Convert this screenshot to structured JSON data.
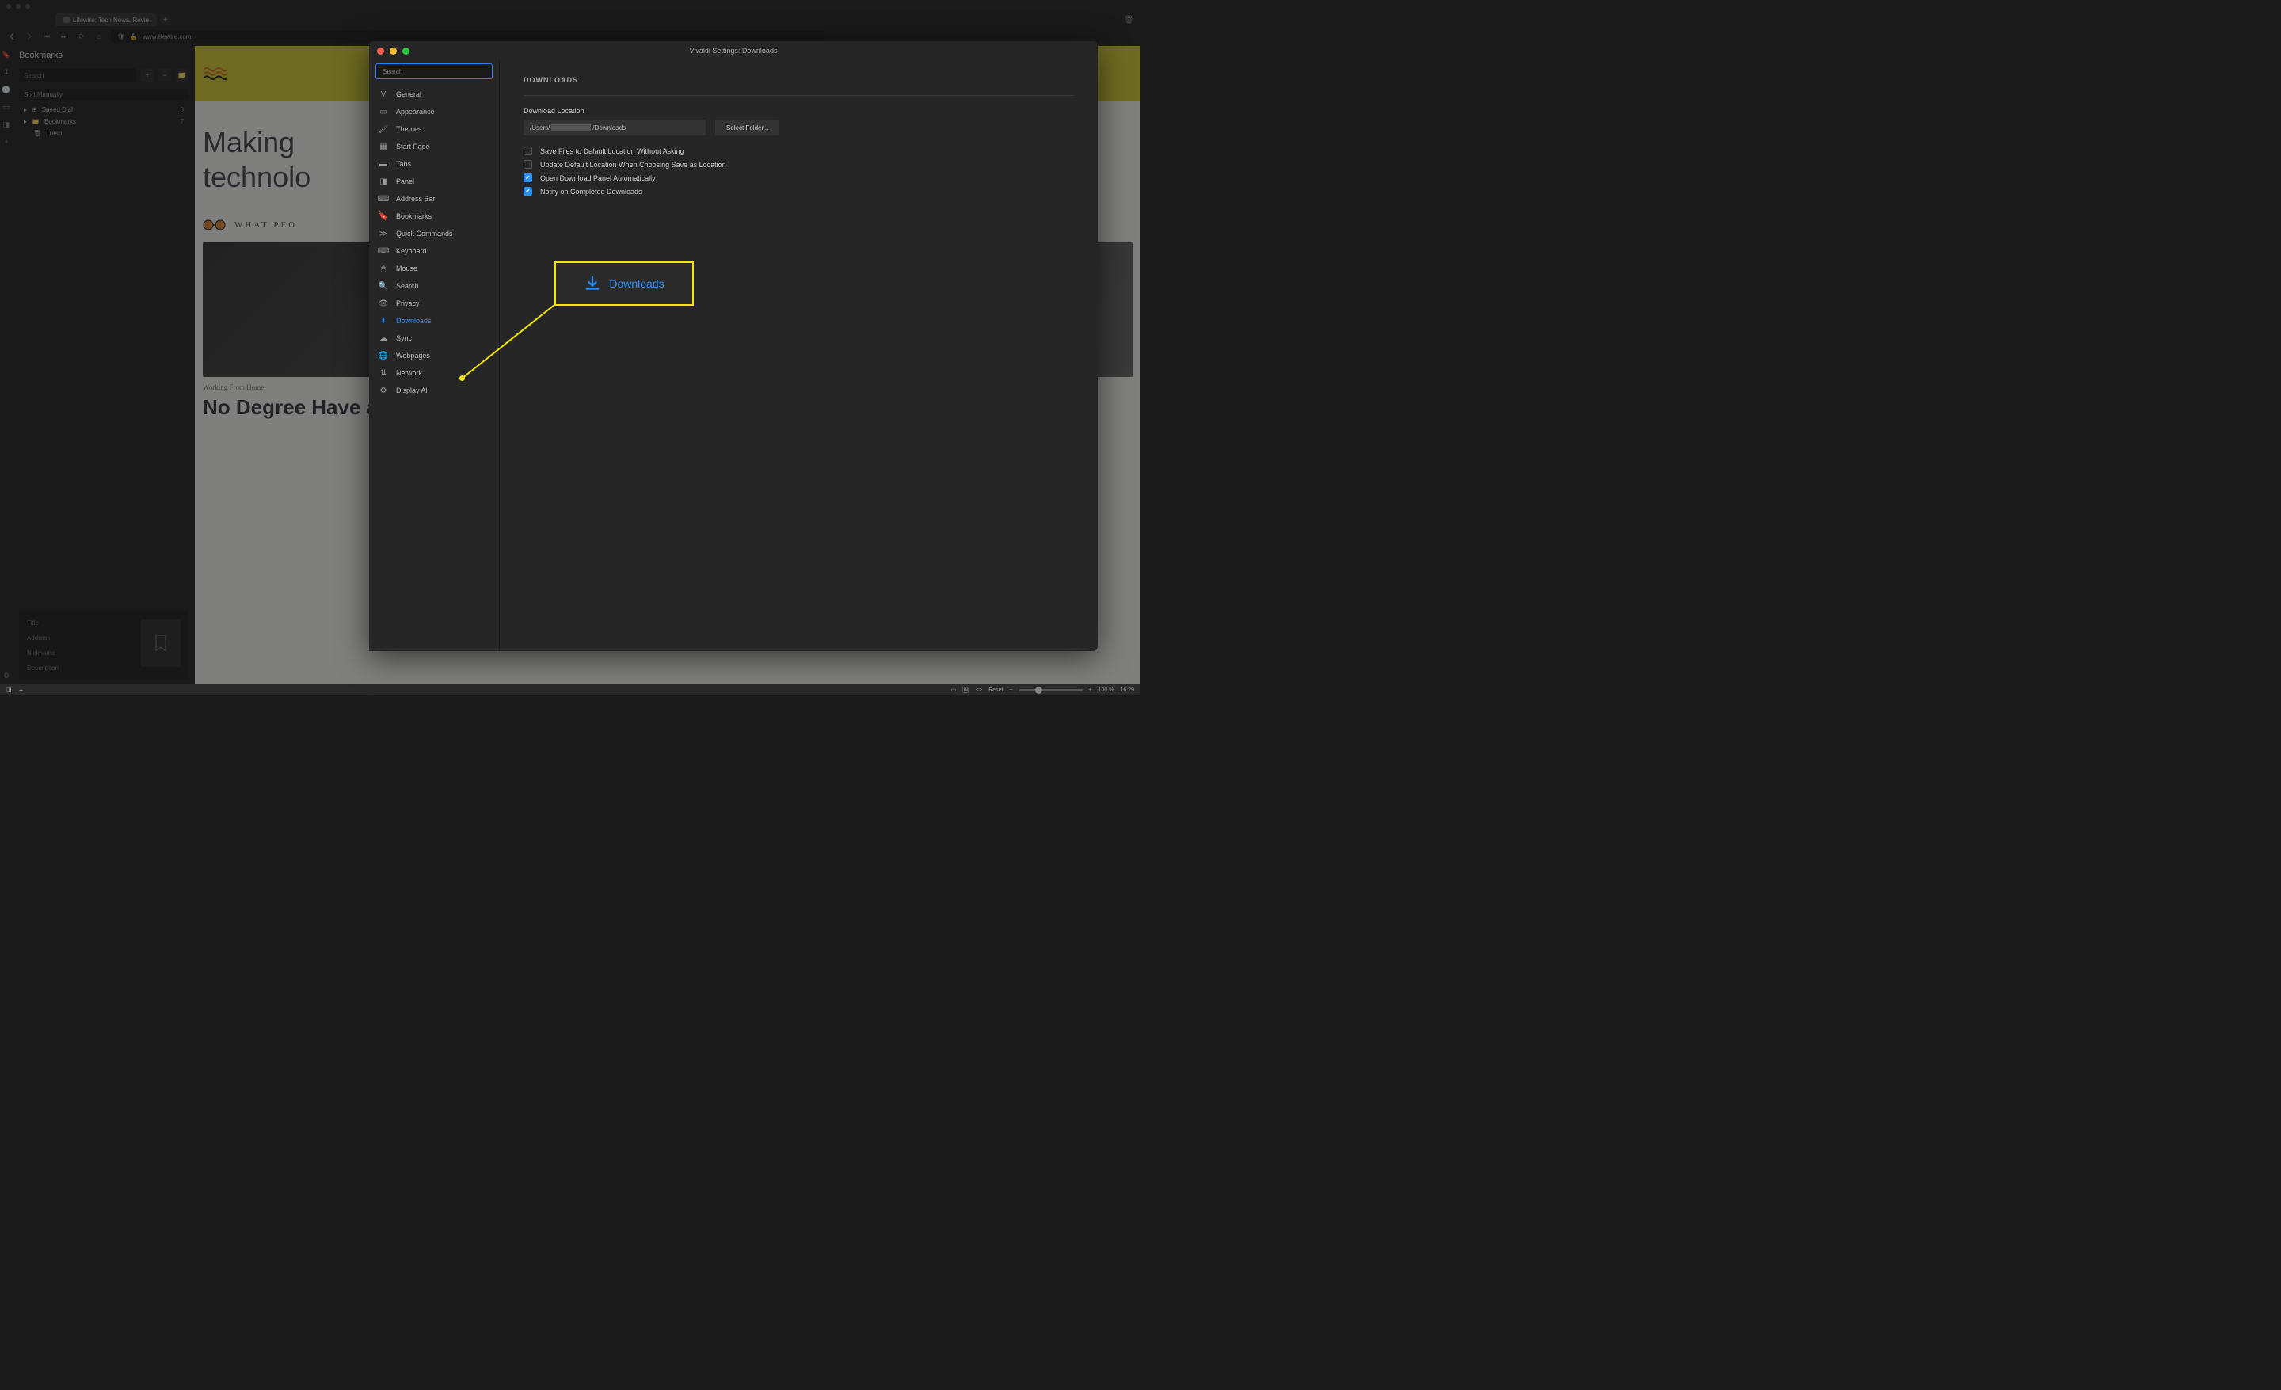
{
  "browser": {
    "tab_title": "Lifewire: Tech News, Revie",
    "url": "www.lifewire.com"
  },
  "bookmarks_panel": {
    "title": "Bookmarks",
    "search_placeholder": "Search",
    "sort_label": "Sort Manually",
    "items": [
      {
        "label": "Speed Dial",
        "count": "8"
      },
      {
        "label": "Bookmarks",
        "count": "7"
      },
      {
        "label": "Trash",
        "count": ""
      }
    ],
    "details": {
      "title_label": "Title",
      "address_label": "Address",
      "nickname_label": "Nickname",
      "description_label": "Description"
    }
  },
  "web": {
    "heading_line1": "Making",
    "heading_line2": "technolo",
    "what_label": "WHAT PEO",
    "category": "Working From Home",
    "headline": "No Degree Have a Great Tec Career"
  },
  "settings": {
    "window_title": "Vivaldi Settings: Downloads",
    "search_placeholder": "Search",
    "sidebar": [
      "General",
      "Appearance",
      "Themes",
      "Start Page",
      "Tabs",
      "Panel",
      "Address Bar",
      "Bookmarks",
      "Quick Commands",
      "Keyboard",
      "Mouse",
      "Search",
      "Privacy",
      "Downloads",
      "Sync",
      "Webpages",
      "Network",
      "Display All"
    ],
    "active_sidebar": "Downloads",
    "section_title": "DOWNLOADS",
    "location_label": "Download Location",
    "location_prefix": "/Users/",
    "location_suffix": "/Downloads",
    "select_folder_label": "Select Folder...",
    "checkboxes": [
      {
        "label": "Save Files to Default Location Without Asking",
        "checked": false
      },
      {
        "label": "Update Default Location When Choosing Save as Location",
        "checked": false
      },
      {
        "label": "Open Download Panel Automatically",
        "checked": true
      },
      {
        "label": "Notify on Completed Downloads",
        "checked": true
      }
    ]
  },
  "callout": {
    "label": "Downloads"
  },
  "status_bar": {
    "reset_label": "Reset",
    "zoom_label": "100 %",
    "time": "16:29"
  }
}
